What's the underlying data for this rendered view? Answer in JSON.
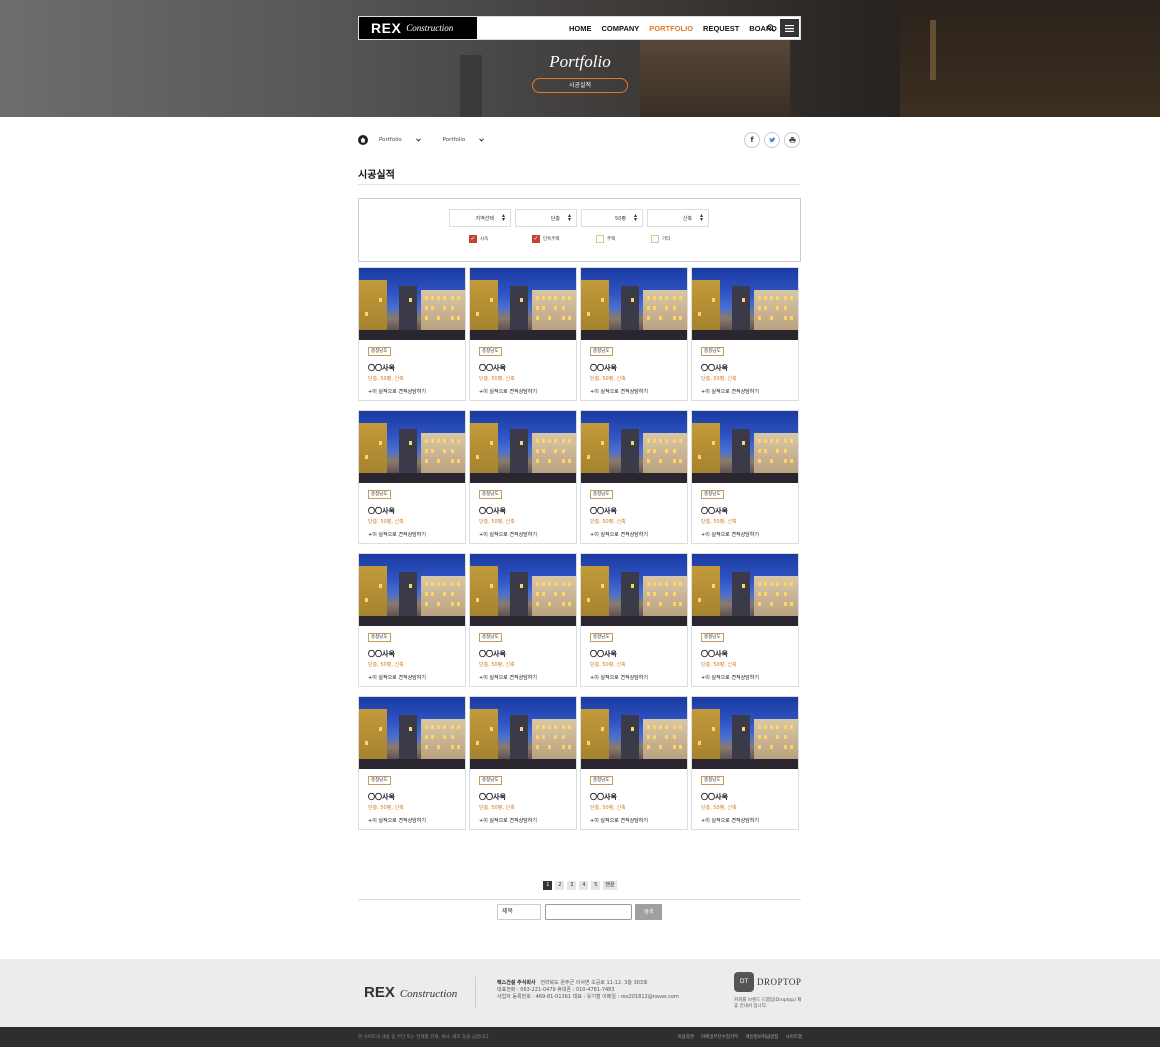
{
  "header": {
    "logo_main": "REX",
    "logo_sub": "Construction",
    "nav": [
      "HOME",
      "COMPANY",
      "PORTFOLIO",
      "REQUEST",
      "BOARD"
    ],
    "nav_active": "PORTFOLIO",
    "search_icon": "search-icon",
    "menu_icon": "hamburger-icon",
    "accent_color": "#e07a2a"
  },
  "hero": {
    "title": "Portfolio",
    "pill": "시공실적"
  },
  "breadcrumb": {
    "home_icon": "home-icon",
    "items": [
      "Portfolio",
      "Portfolio"
    ]
  },
  "share": [
    "f",
    "t",
    "print"
  ],
  "page": {
    "title": "시공실적"
  },
  "filter": {
    "selects": [
      "지역선택",
      "단층",
      "50평",
      "신축"
    ],
    "checkboxes": [
      {
        "label": "사옥",
        "checked": true
      },
      {
        "label": "단독주택",
        "checked": true
      },
      {
        "label": "주택",
        "checked": false
      },
      {
        "label": "기타",
        "checked": false
      }
    ]
  },
  "cards": [
    {
      "tag": "충청남도",
      "name": "〇〇사옥",
      "spec": "단층, 50평, 신축",
      "link": "+이 실적으로 견적상담하기"
    },
    {
      "tag": "충청남도",
      "name": "〇〇사옥",
      "spec": "단층, 50평, 신축",
      "link": "+이 실적으로 견적상담하기"
    },
    {
      "tag": "충청남도",
      "name": "〇〇사옥",
      "spec": "단층, 50평, 신축",
      "link": "+이 실적으로 견적상담하기"
    },
    {
      "tag": "충청남도",
      "name": "〇〇사옥",
      "spec": "단층, 50평, 신축",
      "link": "+이 실적으로 견적상담하기"
    },
    {
      "tag": "충청남도",
      "name": "〇〇사옥",
      "spec": "단층, 50평, 신축",
      "link": "+이 실적으로 견적상담하기"
    },
    {
      "tag": "충청남도",
      "name": "〇〇사옥",
      "spec": "단층, 50평, 신축",
      "link": "+이 실적으로 견적상담하기"
    },
    {
      "tag": "충청남도",
      "name": "〇〇사옥",
      "spec": "단층, 50평, 신축",
      "link": "+이 실적으로 견적상담하기"
    },
    {
      "tag": "충청남도",
      "name": "〇〇사옥",
      "spec": "단층, 50평, 신축",
      "link": "+이 실적으로 견적상담하기"
    },
    {
      "tag": "충청남도",
      "name": "〇〇사옥",
      "spec": "단층, 50평, 신축",
      "link": "+이 실적으로 견적상담하기"
    },
    {
      "tag": "충청남도",
      "name": "〇〇사옥",
      "spec": "단층, 50평, 신축",
      "link": "+이 실적으로 견적상담하기"
    },
    {
      "tag": "충청남도",
      "name": "〇〇사옥",
      "spec": "단층, 50평, 신축",
      "link": "+이 실적으로 견적상담하기"
    },
    {
      "tag": "충청남도",
      "name": "〇〇사옥",
      "spec": "단층, 50평, 신축",
      "link": "+이 실적으로 견적상담하기"
    },
    {
      "tag": "충청남도",
      "name": "〇〇사옥",
      "spec": "단층, 50평, 신축",
      "link": "+이 실적으로 견적상담하기"
    },
    {
      "tag": "충청남도",
      "name": "〇〇사옥",
      "spec": "단층, 50평, 신축",
      "link": "+이 실적으로 견적상담하기"
    },
    {
      "tag": "충청남도",
      "name": "〇〇사옥",
      "spec": "단층, 50평, 신축",
      "link": "+이 실적으로 견적상담하기"
    },
    {
      "tag": "충청남도",
      "name": "〇〇사옥",
      "spec": "단층, 50평, 신축",
      "link": "+이 실적으로 견적상담하기"
    }
  ],
  "pagination": {
    "pages": [
      "1",
      "2",
      "3",
      "4",
      "5"
    ],
    "current": "1",
    "next": "맨끝"
  },
  "search": {
    "field": "제목",
    "button": "검색"
  },
  "footer": {
    "logo_main": "REX",
    "logo_sub": "Construction",
    "company": "렉스건설 주식회사",
    "address": "전라북도 완주군 이서면 오공로 11-12, 3층 303호",
    "line2": "대표전화 : 063-221-0479    휴대폰 : 010-4781-7483",
    "line3": "사업자 등록번호 : 469-81-01361    대표 : 유기철    이메일 : rex201812@naver.com",
    "droptop_name": "DROPTOP",
    "droptop_badge": "DT",
    "droptop_desc": "커피를 브랜드 드롭탑(Droptop) 제휴 안내서 입니다.",
    "copyright": "본 사이트의 내용 중 무단 또는 전재를 전재, 복사, 배포 등을 금합니다.",
    "links": [
      "이용약관",
      "이메일무단수집거부",
      "개인정보취급방침",
      "사이트맵"
    ]
  }
}
